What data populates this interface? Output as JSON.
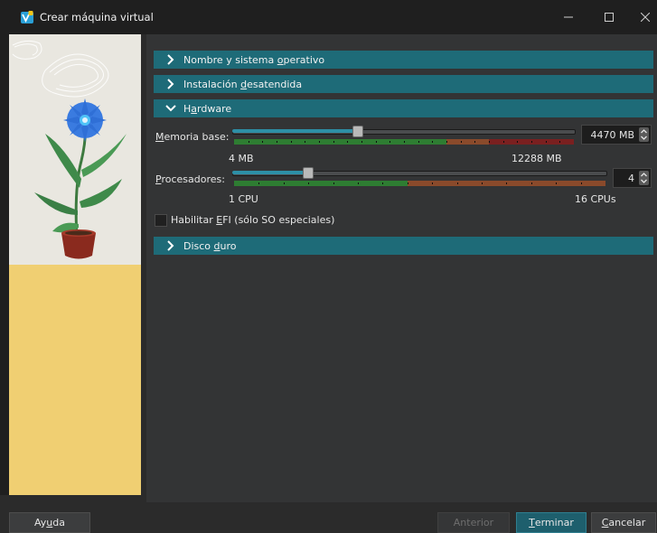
{
  "window": {
    "title": "Crear máquina virtual",
    "controls": [
      "minimize-icon",
      "maximize-icon",
      "close-icon"
    ]
  },
  "sections": [
    {
      "label_pre": "Nombre y sistema ",
      "mnemonic": "o",
      "label_post": "perativo",
      "expanded": false
    },
    {
      "label_pre": "Instalación ",
      "mnemonic": "d",
      "label_post": "esatendida",
      "expanded": false
    },
    {
      "label_pre": "H",
      "mnemonic": "a",
      "label_post": "rdware",
      "expanded": true
    },
    {
      "label_pre": "Disco ",
      "mnemonic": "d",
      "label_post": "uro",
      "expanded": false
    }
  ],
  "hardware": {
    "memory": {
      "label_mnemonic": "M",
      "label_rest": "emoria base:",
      "value_text": "4470 MB",
      "min_label": "4 MB",
      "max_label": "12288 MB",
      "value": 4470,
      "min": 4,
      "max": 12288,
      "zones": [
        {
          "color": "#2e7d32",
          "from": 0,
          "to": 0.625
        },
        {
          "color": "#8a4a2b",
          "from": 0.625,
          "to": 0.75
        },
        {
          "color": "#7a2020",
          "from": 0.75,
          "to": 1
        }
      ]
    },
    "cpu": {
      "label_mnemonic": "P",
      "label_rest": "rocesadores:",
      "value_text": "4",
      "min_label": "1 CPU",
      "max_label": "16 CPUs",
      "value": 4,
      "min": 1,
      "max": 16,
      "zones": [
        {
          "color": "#2e7d32",
          "from": 0,
          "to": 0.467
        },
        {
          "color": "#8a4a2b",
          "from": 0.467,
          "to": 1
        }
      ]
    },
    "efi": {
      "label_pre": "Habilitar ",
      "mnemonic": "E",
      "label_post": "FI (sólo SO especiales)",
      "checked": false
    }
  },
  "buttons": {
    "help": {
      "pre": "Ay",
      "mnemonic": "u",
      "post": "da"
    },
    "back": {
      "label": "Anterior"
    },
    "finish": {
      "mnemonic": "T",
      "post": "erminar"
    },
    "cancel": {
      "mnemonic": "C",
      "post": "ancelar"
    }
  }
}
